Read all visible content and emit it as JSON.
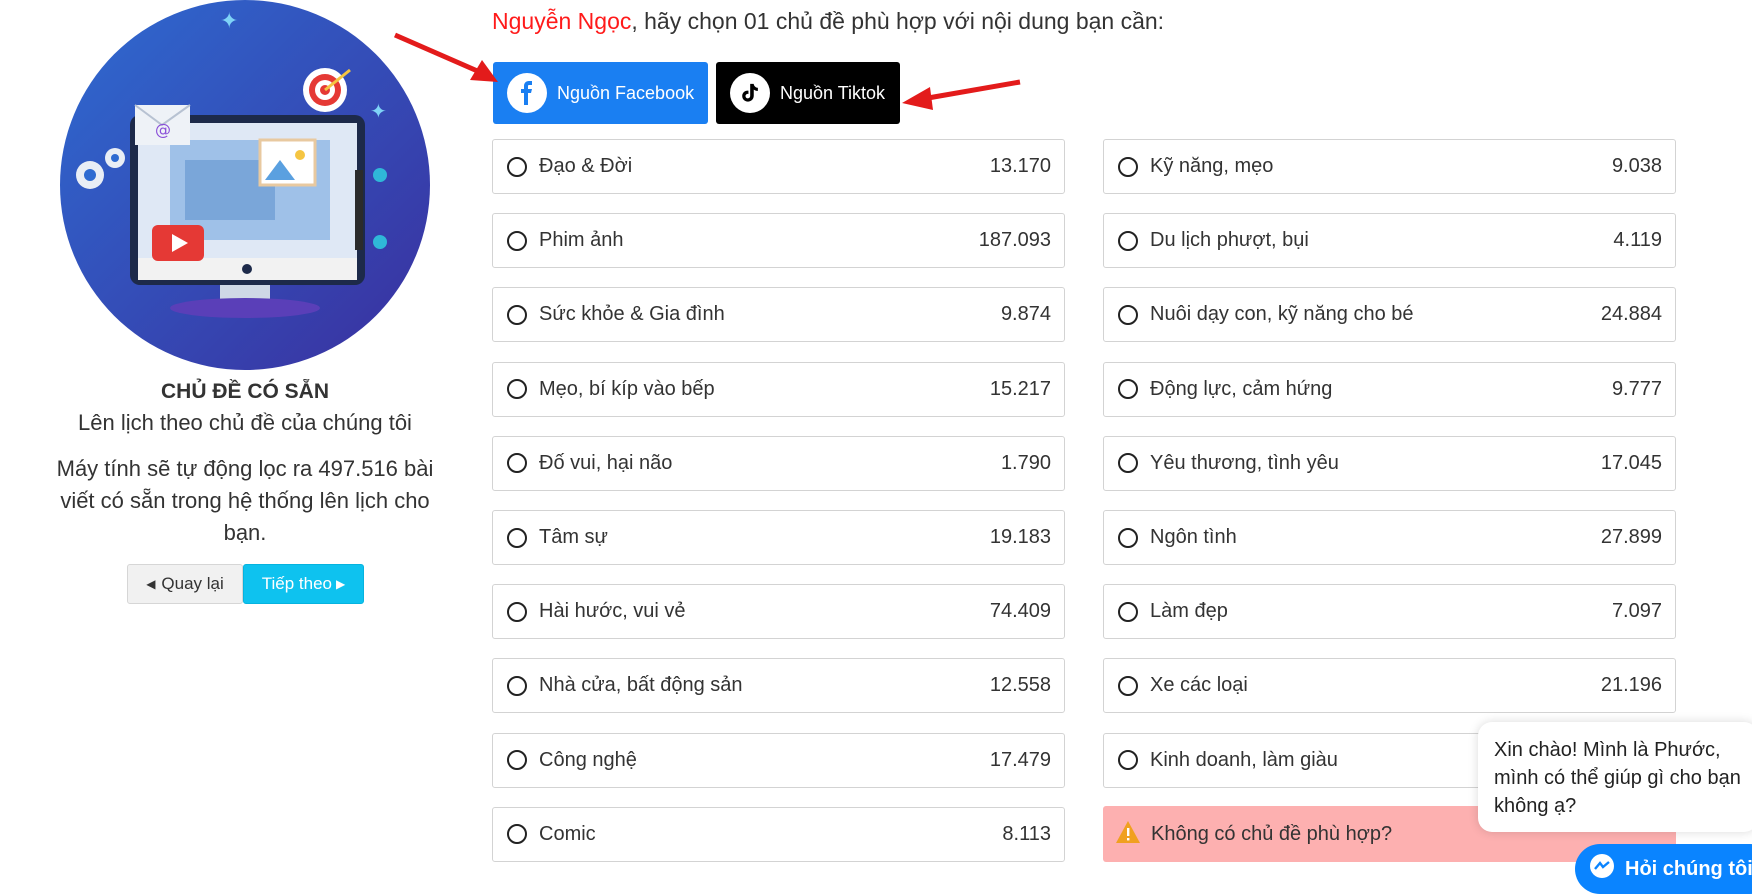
{
  "panel": {
    "title": "CHỦ ĐỀ CÓ SẴN",
    "subtitle": "Lên lịch theo chủ đề của chúng tôi",
    "description": "Máy tính sẽ tự động lọc ra 497.516 bài viết có sẵn trong hệ thống lên lịch cho bạn.",
    "back_label": "Quay lại",
    "next_label": "Tiếp theo"
  },
  "prompt": {
    "user": "Nguyễn Ngọc",
    "text": ", hãy chọn 01 chủ đề phù hợp với nội dung bạn cần:"
  },
  "sources": {
    "facebook": "Nguồn Facebook",
    "tiktok": "Nguồn Tiktok"
  },
  "topics_left": [
    {
      "label": "Đạo & Đời",
      "count": "13.170"
    },
    {
      "label": "Phim ảnh",
      "count": "187.093"
    },
    {
      "label": "Sức khỏe & Gia đình",
      "count": "9.874"
    },
    {
      "label": "Mẹo, bí kíp vào bếp",
      "count": "15.217"
    },
    {
      "label": "Đố vui, hại não",
      "count": "1.790"
    },
    {
      "label": "Tâm sự",
      "count": "19.183"
    },
    {
      "label": "Hài hước, vui vẻ",
      "count": "74.409"
    },
    {
      "label": "Nhà cửa, bất động sản",
      "count": "12.558"
    },
    {
      "label": "Công nghệ",
      "count": "17.479"
    },
    {
      "label": "Comic",
      "count": "8.113"
    }
  ],
  "topics_right": [
    {
      "label": "Kỹ năng, mẹo",
      "count": "9.038"
    },
    {
      "label": "Du lịch phượt, bụi",
      "count": "4.119"
    },
    {
      "label": "Nuôi dạy con, kỹ năng cho bé",
      "count": "24.884"
    },
    {
      "label": "Động lực, cảm hứng",
      "count": "9.777"
    },
    {
      "label": "Yêu thương, tình yêu",
      "count": "17.045"
    },
    {
      "label": "Ngôn tình",
      "count": "27.899"
    },
    {
      "label": "Làm đẹp",
      "count": "7.097"
    },
    {
      "label": "Xe các loại",
      "count": "21.196"
    },
    {
      "label": "Kinh doanh, làm giàu",
      "count": ""
    }
  ],
  "no_topic": "Không có chủ đề phù hợp?",
  "chat": {
    "greeting": "Xin chào! Mình là Phước, mình có thể giúp gì cho bạn không ạ?",
    "button": "Hỏi chúng tôi"
  },
  "colors": {
    "facebook": "#1a7ff2",
    "tiktok": "#000000",
    "next_button": "#0ec2ef",
    "user_name": "#ff1a1a",
    "warning_bg": "#fdb0b0",
    "arrow": "#e31b1b"
  },
  "icons": {
    "facebook": "facebook-icon",
    "tiktok": "tiktok-icon",
    "warning": "warning-icon",
    "messenger": "messenger-icon"
  }
}
